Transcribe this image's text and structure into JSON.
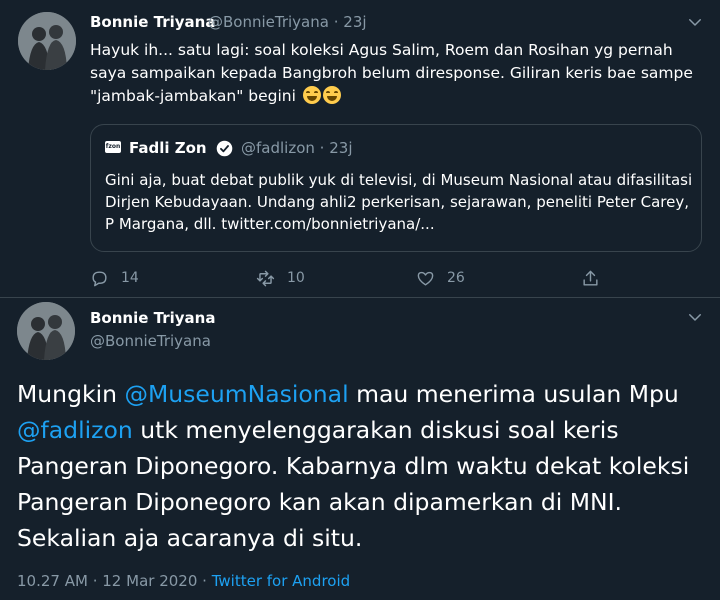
{
  "tweet1": {
    "author_name": "Bonnie Triyana",
    "handle": "@BonnieTriyana",
    "separator": "·",
    "time": "23j",
    "text": "Hayuk ih... satu lagi: soal koleksi Agus Salim, Roem dan Rosihan yg pernah saya sampaikan kepada Bangbroh belum diresponse. Giliran keris bae sampe \"jambak-jambakan\" begini",
    "emojis": [
      "face-with-tears-of-joy",
      "face-with-tears-of-joy"
    ],
    "quoted": {
      "logo_text": "fzon",
      "author_name": "Fadli Zon",
      "verified": true,
      "handle": "@fadlizon",
      "separator": "·",
      "time": "23j",
      "text": "Gini aja, buat debat publik yuk di televisi, di Museum Nasional atau difasilitasi Dirjen Kebudayaan. Undang ahli2 perkerisan, sejarawan, peneliti Peter Carey, P Margana, dll. twitter.com/bonnietriyana/..."
    },
    "actions": {
      "reply_count": "14",
      "retweet_count": "10",
      "like_count": "26"
    }
  },
  "tweet2": {
    "author_name": "Bonnie Triyana",
    "handle": "@BonnieTriyana",
    "text_parts": {
      "p1": "Mungkin ",
      "mention1": "@MuseumNasional",
      "p2": " mau menerima usulan Mpu ",
      "mention2": "@fadlizon",
      "p3": " utk menyelenggarakan diskusi soal keris Pangeran Diponegoro. Kabarnya dlm waktu dekat koleksi Pangeran Diponegoro kan akan dipamerkan di MNI. Sekalian aja acaranya di situ."
    },
    "time": "10.27 AM",
    "separator": "·",
    "date": "12 Mar 2020",
    "source": "Twitter for Android"
  },
  "colors": {
    "background": "#15202b",
    "text": "#ffffff",
    "secondary": "#8899a6",
    "link": "#1da1f2",
    "border": "#38444d"
  }
}
